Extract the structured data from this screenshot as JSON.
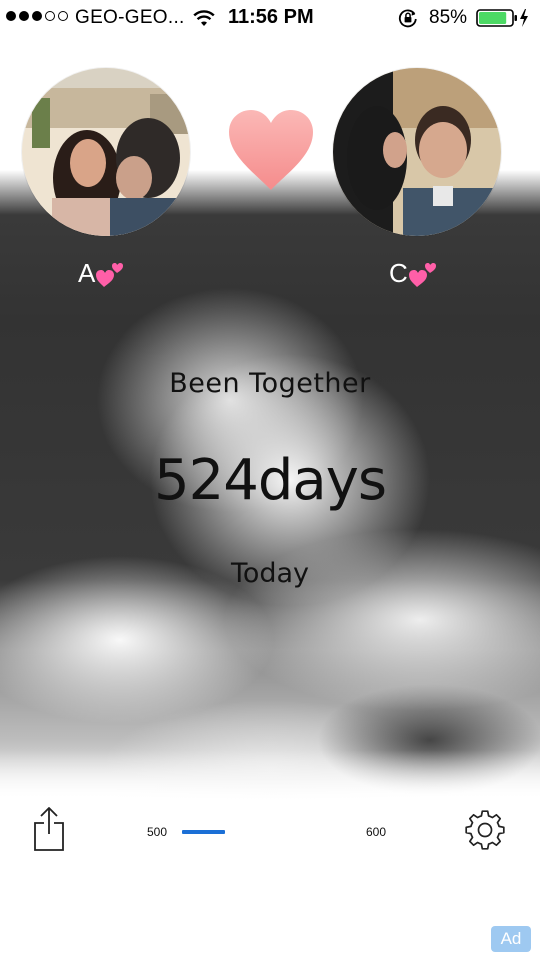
{
  "status_bar": {
    "signal_filled": 3,
    "signal_total": 5,
    "carrier": "GEO-GEO...",
    "wifi_icon": "wifi-icon",
    "time": "11:56 PM",
    "rotation_lock_icon": "rotation-lock-icon",
    "battery_percent": "85%",
    "battery_level": 0.85,
    "battery_color": "#4cd964"
  },
  "couple": {
    "left_name": "A",
    "right_name": "C",
    "name_emoji_icon": "two-hearts-icon",
    "center_icon": "heart-icon",
    "heart_color": "#f7a1a1"
  },
  "counter": {
    "heading": "Been Together",
    "days": "524days",
    "date_label": "Today"
  },
  "milestone": {
    "min_label": "500",
    "max_label": "600",
    "progress_fraction": 0.24,
    "bar_color": "#1b6fd6"
  },
  "toolbar": {
    "share_icon": "share-icon",
    "settings_icon": "gear-icon"
  },
  "ad": {
    "label": "Ad",
    "color": "#9ec9f1"
  }
}
